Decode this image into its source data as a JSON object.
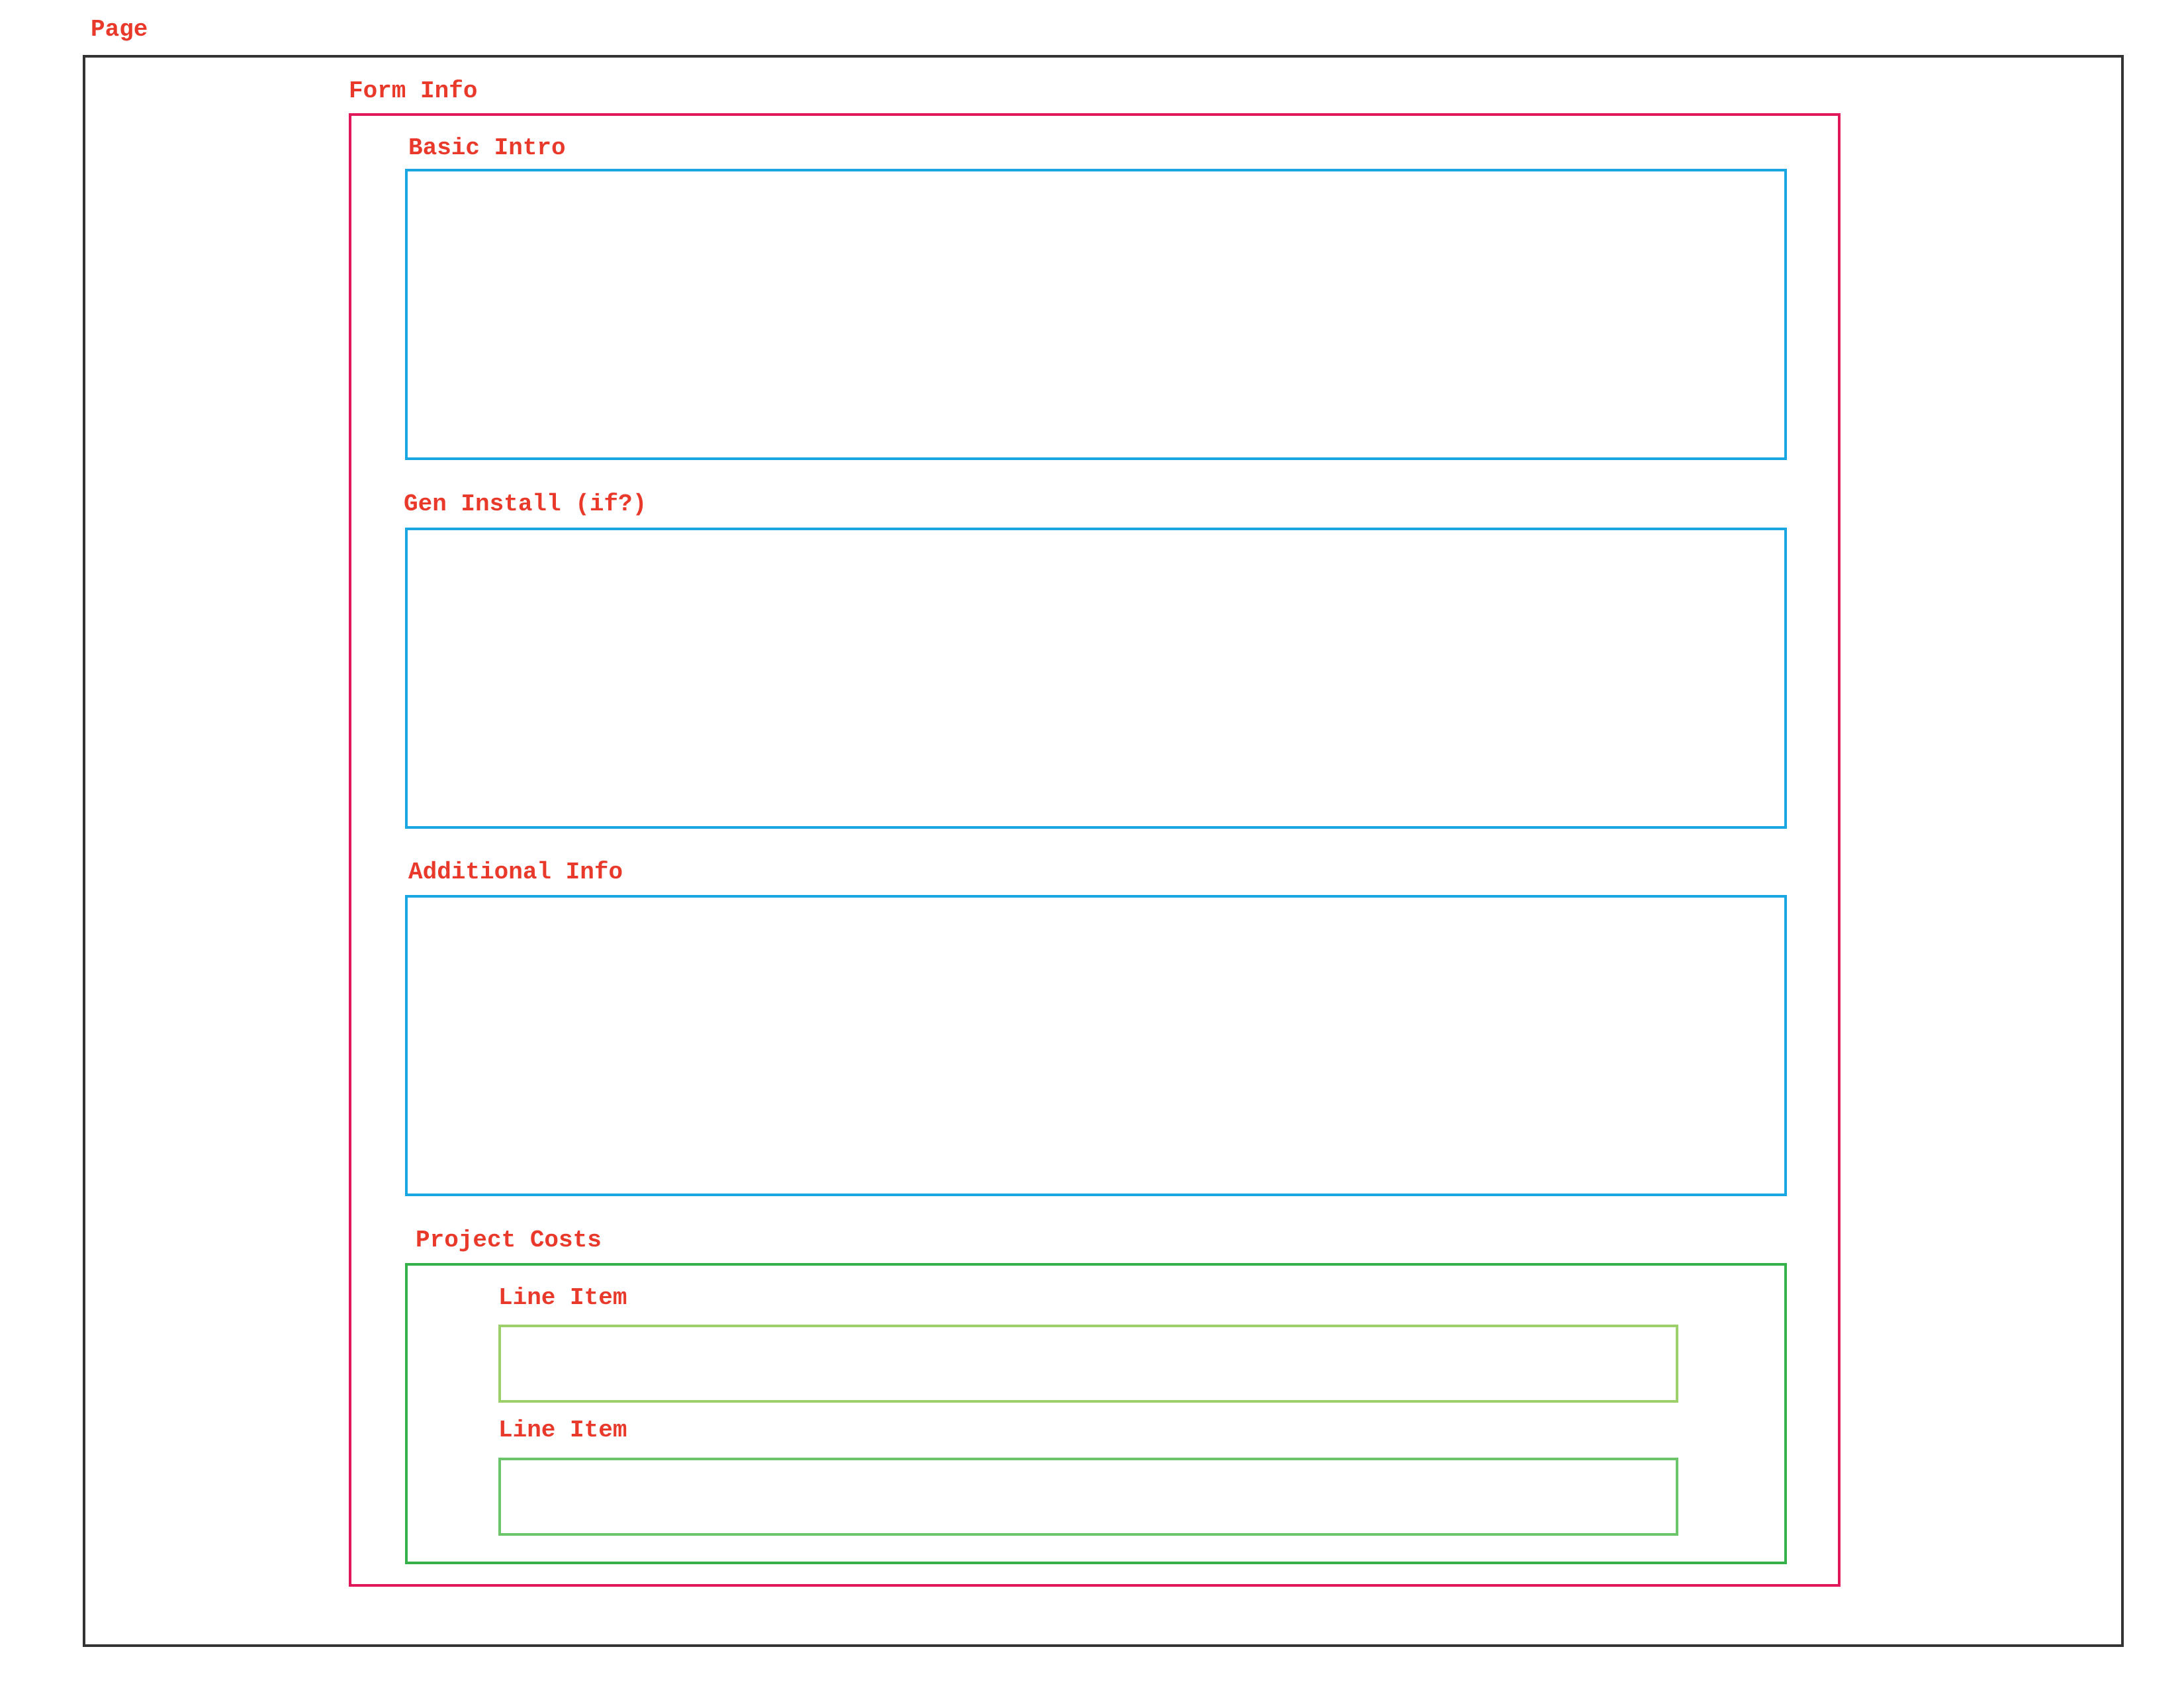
{
  "colors": {
    "label_text": "#e8392b",
    "page_border": "#333333",
    "form_border": "#e0185a",
    "section_border": "#1aa6e0",
    "costs_border": "#36b04a",
    "line_item_border_1": "#9bd06a",
    "line_item_border_2": "#6cc56a"
  },
  "page": {
    "label": "Page",
    "form_info": {
      "label": "Form Info",
      "sections": [
        {
          "label": "Basic Intro"
        },
        {
          "label": "Gen Install (if?)"
        },
        {
          "label": "Additional Info"
        }
      ],
      "project_costs": {
        "label": "Project Costs",
        "line_items": [
          {
            "label": "Line Item"
          },
          {
            "label": "Line Item"
          }
        ]
      }
    }
  }
}
